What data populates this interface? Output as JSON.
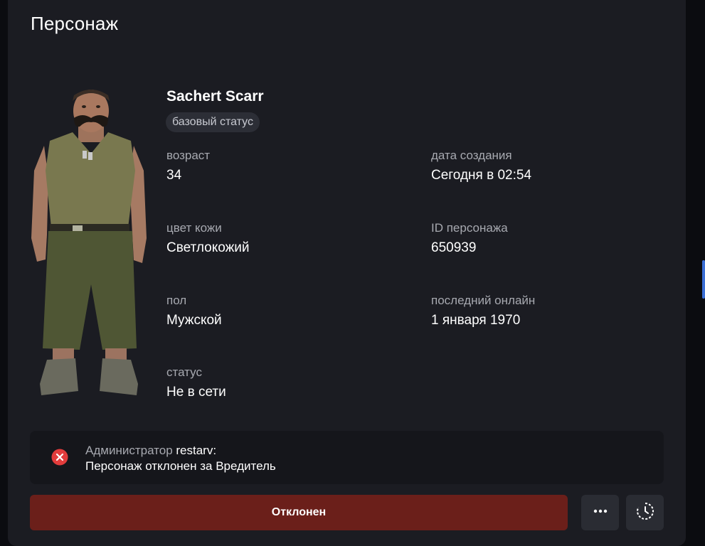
{
  "page": {
    "title": "Персонаж"
  },
  "character": {
    "name": "Sachert Scarr",
    "badge": "базовый статус",
    "fields": {
      "age": {
        "label": "возраст",
        "value": "34"
      },
      "created": {
        "label": "дата создания",
        "value": "Сегодня в 02:54"
      },
      "skin": {
        "label": "цвет кожи",
        "value": "Светлокожий"
      },
      "id": {
        "label": "ID персонажа",
        "value": "650939"
      },
      "gender": {
        "label": "пол",
        "value": "Мужской"
      },
      "last_online": {
        "label": "последний онлайн",
        "value": "1 января 1970"
      },
      "status": {
        "label": "статус",
        "value": "Не в сети"
      }
    }
  },
  "notice": {
    "prefix": "Администратор",
    "admin": "restarv:",
    "message": "Персонаж отклонен за Вредитель",
    "icon": "x-circle-icon",
    "color": "#e23c3c"
  },
  "actions": {
    "main_label": "Отклонен",
    "main_color": "#6b1f1a",
    "more_icon": "more-horizontal-icon",
    "history_icon": "history-clock-icon"
  }
}
